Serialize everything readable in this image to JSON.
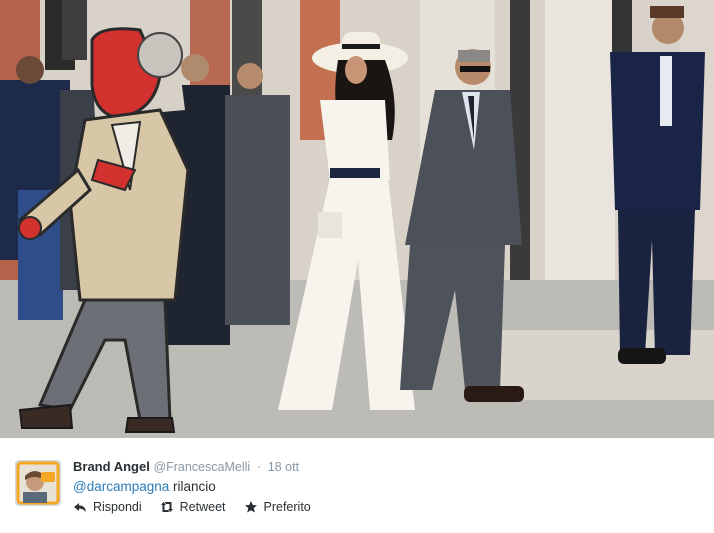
{
  "tweet": {
    "author_name": "Brand Angel",
    "author_handle": "@FrancescaMelli",
    "separator": "·",
    "timestamp": "18 ott",
    "mention": "@darcampagna",
    "body": " rilancio",
    "actions": {
      "reply_label": "Rispondi",
      "retweet_label": "Retweet",
      "favorite_label": "Preferito"
    }
  },
  "icons": {
    "reply": "reply-icon",
    "retweet": "retweet-icon",
    "favorite": "star-icon"
  },
  "colors": {
    "name": "#292f33",
    "meta": "#8899a6",
    "link": "#2b7bb9",
    "avatar_border": "#f5a623"
  }
}
